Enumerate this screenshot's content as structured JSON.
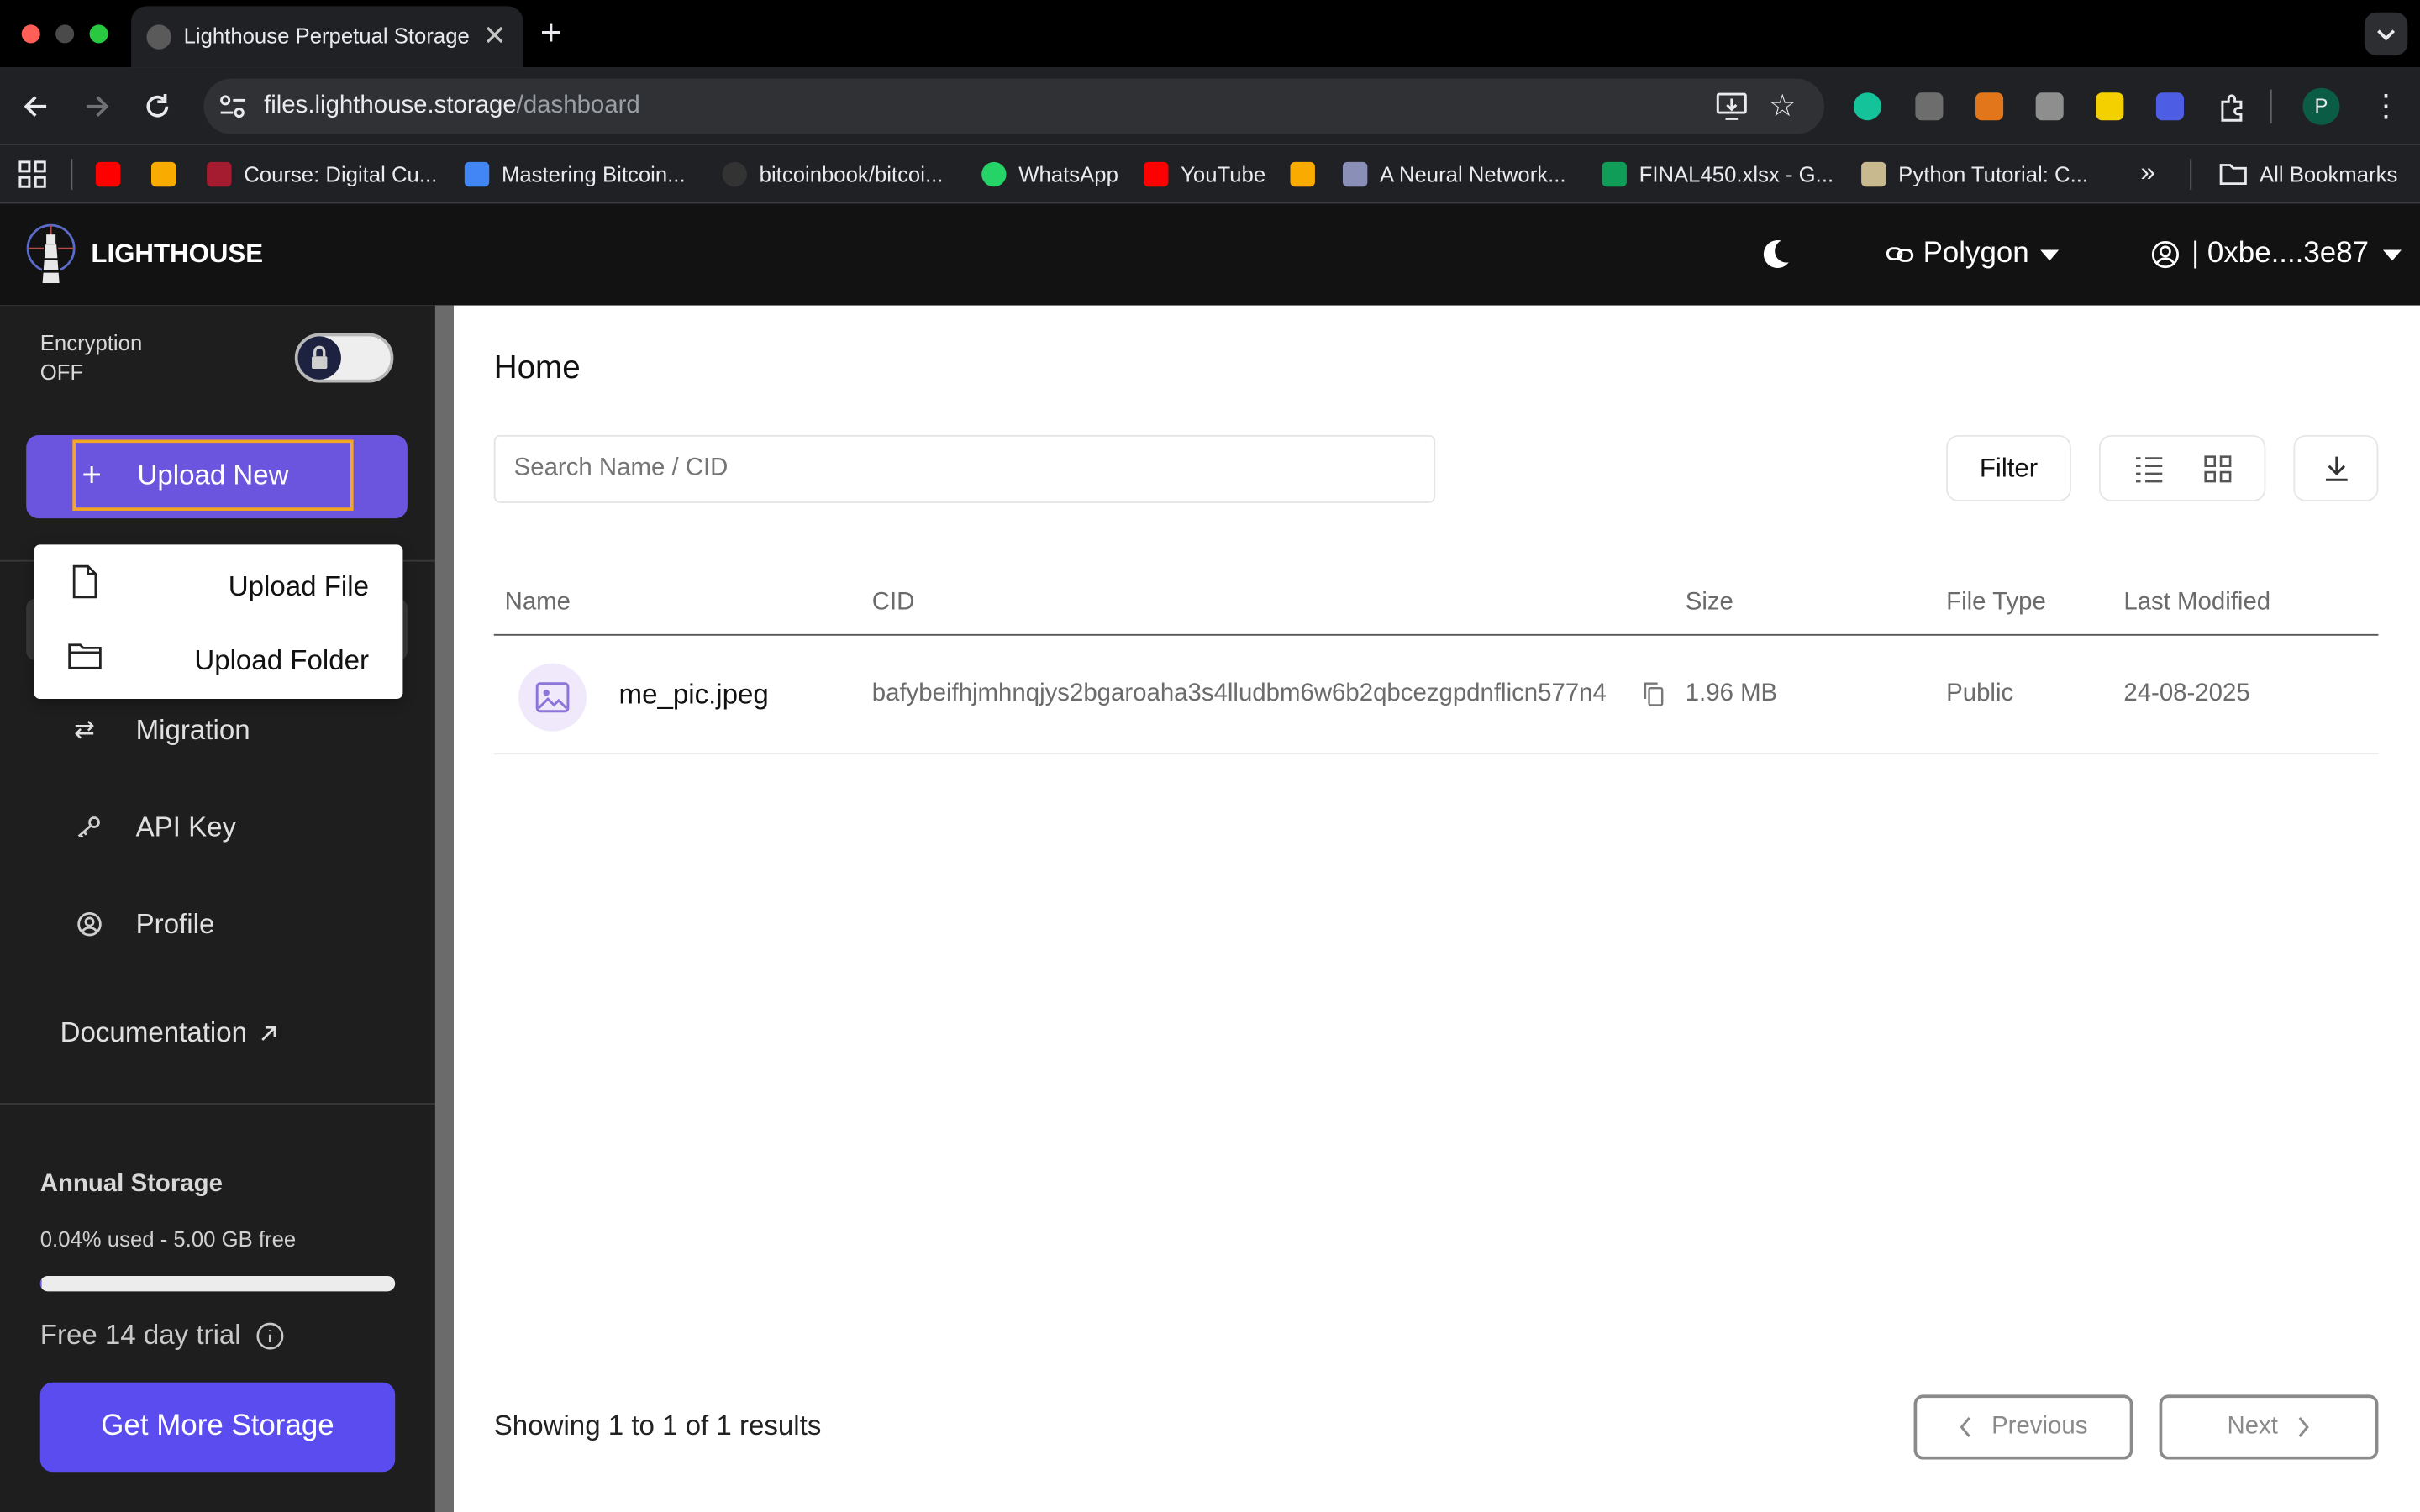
{
  "browser": {
    "tab_title": "Lighthouse Perpetual Storage",
    "url_host": "files.lighthouse.storage",
    "url_path": "/dashboard",
    "bookmarks": [
      {
        "label": "Course: Digital Cu...",
        "icon": "harvard-icon"
      },
      {
        "label": "Mastering Bitcoin...",
        "icon": "docs-icon"
      },
      {
        "label": "bitcoinbook/bitcoi...",
        "icon": "github-icon"
      },
      {
        "label": "WhatsApp",
        "icon": "whatsapp-icon"
      },
      {
        "label": "YouTube",
        "icon": "youtube-icon"
      },
      {
        "label": "A Neural Network...",
        "icon": "page-icon"
      },
      {
        "label": "FINAL450.xlsx - G...",
        "icon": "drive-icon"
      },
      {
        "label": "Python Tutorial: C...",
        "icon": "page-icon"
      }
    ],
    "all_bookmarks": "All Bookmarks",
    "profile_initial": "P"
  },
  "app": {
    "brand": "LIGHTHOUSE",
    "network": "Polygon",
    "account": "| 0xbe....3e87"
  },
  "sidebar": {
    "encryption_label": "Encryption",
    "encryption_state": "OFF",
    "upload_button": "Upload New",
    "upload_menu": {
      "file": "Upload File",
      "folder": "Upload Folder"
    },
    "nav": {
      "migration": "Migration",
      "api_key": "API Key",
      "profile": "Profile"
    },
    "documentation": "Documentation",
    "storage_title": "Annual Storage",
    "storage_usage": "0.04% used - 5.00 GB free",
    "storage_used_fraction": 0.0004,
    "trial": "Free 14 day trial",
    "get_more": "Get More Storage"
  },
  "main": {
    "title": "Home",
    "search_placeholder": "Search Name / CID",
    "filter": "Filter",
    "columns": {
      "name": "Name",
      "cid": "CID",
      "size": "Size",
      "type": "File Type",
      "modified": "Last Modified"
    },
    "rows": [
      {
        "name": "me_pic.jpeg",
        "cid": "bafybeifhjmhnqjys2bgaroaha3s4lludbm6w6b2qbcezgpdnflicn577n4",
        "size": "1.96 MB",
        "type": "Public",
        "modified": "24-08-2025"
      }
    ],
    "results": "Showing 1 to 1 of 1 results",
    "previous": "Previous",
    "next": "Next"
  },
  "colors": {
    "accent": "#6c55de",
    "primary_button": "#5b4cf0",
    "focus_outline": "#f5a623"
  }
}
